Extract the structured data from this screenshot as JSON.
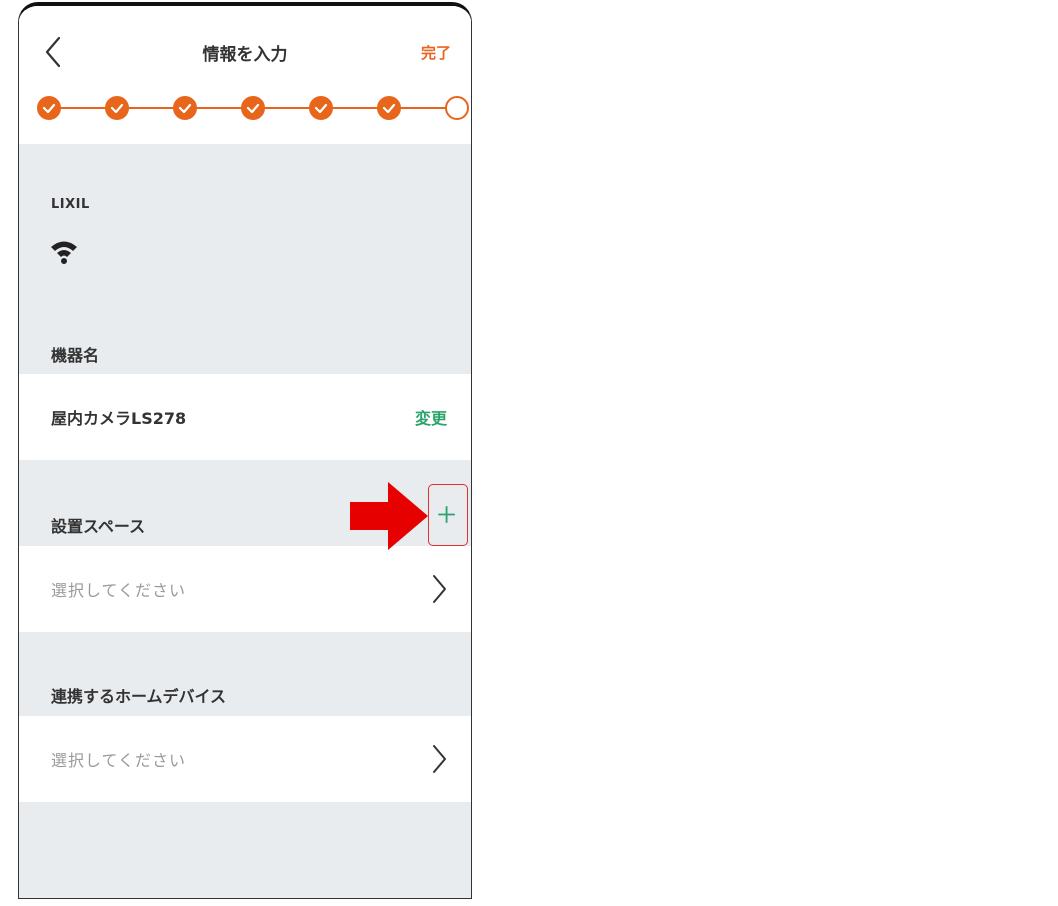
{
  "header": {
    "title": "情報を入力",
    "done_label": "完了",
    "back_icon": "chevron-left-icon"
  },
  "progress": {
    "total_steps": 7,
    "completed_steps": 6,
    "accent_color": "#e8661b"
  },
  "device": {
    "brand": "LIXIL",
    "connection_icon": "wifi-icon"
  },
  "device_name": {
    "label": "機器名",
    "value": "屋内カメラLS278",
    "change_label": "変更",
    "change_color": "#2da36b"
  },
  "install_space": {
    "label": "設置スペース",
    "placeholder": "選択してください",
    "add_icon": "plus-icon"
  },
  "linked_devices": {
    "label": "連携するホームデバイス",
    "placeholder": "選択してください"
  },
  "annotation": {
    "arrow_color": "#e60000",
    "highlight_color": "#e03030"
  }
}
